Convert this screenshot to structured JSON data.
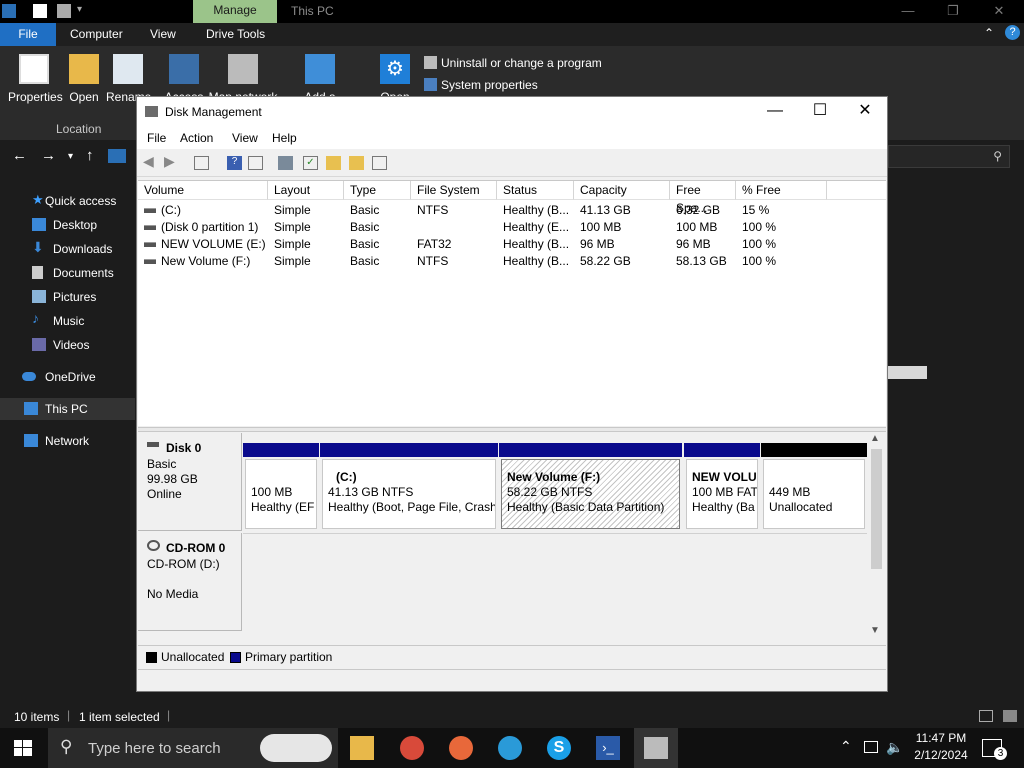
{
  "explorer": {
    "title": "This PC",
    "context_tab": "Manage",
    "ribbon_tabs": [
      "File",
      "Computer",
      "View",
      "Drive Tools"
    ],
    "ribbon_buttons": [
      "Properties",
      "Open",
      "Rename",
      "Access",
      "Map network",
      "Add a network",
      "Open"
    ],
    "ribbon_small": [
      "Uninstall or change a program",
      "System properties"
    ],
    "ribbon_group": "Location",
    "nav": [
      {
        "label": "Quick access",
        "icon": "star-icon"
      },
      {
        "label": "Desktop",
        "icon": "desktop-folder-icon"
      },
      {
        "label": "Downloads",
        "icon": "download-arrow-icon"
      },
      {
        "label": "Documents",
        "icon": "document-icon"
      },
      {
        "label": "Pictures",
        "icon": "picture-icon"
      },
      {
        "label": "Music",
        "icon": "music-note-icon"
      },
      {
        "label": "Videos",
        "icon": "video-icon"
      },
      {
        "label": "OneDrive",
        "icon": "cloud-icon"
      },
      {
        "label": "This PC",
        "icon": "computer-icon"
      },
      {
        "label": "Network",
        "icon": "network-icon"
      }
    ],
    "status": {
      "items": "10 items",
      "selected": "1 item selected"
    }
  },
  "disk_mgmt": {
    "title": "Disk Management",
    "menu": [
      "File",
      "Action",
      "View",
      "Help"
    ],
    "columns": [
      "Volume",
      "Layout",
      "Type",
      "File System",
      "Status",
      "Capacity",
      "Free Spa...",
      "% Free"
    ],
    "volumes": [
      {
        "volume": "(C:)",
        "layout": "Simple",
        "type": "Basic",
        "fs": "NTFS",
        "status": "Healthy (B...",
        "capacity": "41.13 GB",
        "free": "6.32 GB",
        "pct": "15 %"
      },
      {
        "volume": "(Disk 0 partition 1)",
        "layout": "Simple",
        "type": "Basic",
        "fs": "",
        "status": "Healthy (E...",
        "capacity": "100 MB",
        "free": "100 MB",
        "pct": "100 %"
      },
      {
        "volume": "NEW VOLUME (E:)",
        "layout": "Simple",
        "type": "Basic",
        "fs": "FAT32",
        "status": "Healthy (B...",
        "capacity": "96 MB",
        "free": "96 MB",
        "pct": "100 %"
      },
      {
        "volume": "New Volume (F:)",
        "layout": "Simple",
        "type": "Basic",
        "fs": "NTFS",
        "status": "Healthy (B...",
        "capacity": "58.22 GB",
        "free": "58.13 GB",
        "pct": "100 %"
      }
    ],
    "disk0": {
      "name": "Disk 0",
      "type": "Basic",
      "size": "99.98 GB",
      "state": "Online",
      "partitions": [
        {
          "title": "",
          "line1": "100 MB",
          "line2": "Healthy (EF"
        },
        {
          "title": "(C:)",
          "line1": "41.13 GB NTFS",
          "line2": "Healthy (Boot, Page File, Crash"
        },
        {
          "title": "New Volume  (F:)",
          "line1": "58.22 GB NTFS",
          "line2": "Healthy (Basic Data Partition)"
        },
        {
          "title": "NEW VOLU",
          "line1": "100 MB FAT",
          "line2": "Healthy (Ba"
        },
        {
          "title": "",
          "line1": "449 MB",
          "line2": "Unallocated"
        }
      ]
    },
    "cdrom": {
      "name": "CD-ROM 0",
      "drive": "CD-ROM (D:)",
      "media": "No Media"
    },
    "legend": [
      "Unallocated",
      "Primary partition"
    ],
    "colors": {
      "primary": "#0a0a8c",
      "unallocated": "#000000",
      "selection": "#7a7a7a"
    }
  },
  "taskbar": {
    "search_placeholder": "Type here to search",
    "time": "11:47 PM",
    "date": "2/12/2024",
    "notifications": "3"
  }
}
